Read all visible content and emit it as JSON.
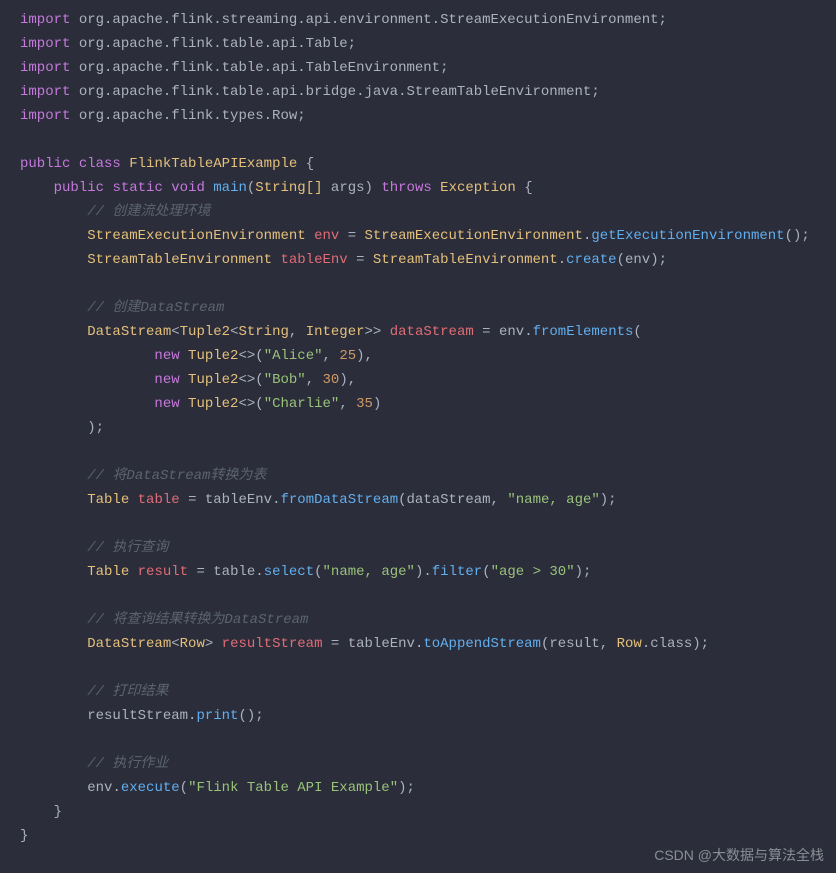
{
  "imports": [
    "org.apache.flink.streaming.api.environment.StreamExecutionEnvironment",
    "org.apache.flink.table.api.Table",
    "org.apache.flink.table.api.TableEnvironment",
    "org.apache.flink.table.api.bridge.java.StreamTableEnvironment",
    "org.apache.flink.types.Row"
  ],
  "kw": {
    "import": "import",
    "public": "public",
    "class": "class",
    "static": "static",
    "void": "void",
    "throws": "throws",
    "new": "new"
  },
  "className": "FlinkTableAPIExample",
  "mainMethod": "main",
  "mainArgsType": "String[]",
  "mainArgsName": "args",
  "throwsType": "Exception",
  "comments": {
    "createEnv": "// 创建流处理环境",
    "createDS": "// 创建DataStream",
    "toTable": "// 将DataStream转换为表",
    "query": "// 执行查询",
    "back": "// 将查询结果转换为DataStream",
    "print": "// 打印结果",
    "execute": "// 执行作业"
  },
  "types": {
    "StreamExecutionEnvironment": "StreamExecutionEnvironment",
    "StreamTableEnvironment": "StreamTableEnvironment",
    "DataStream": "DataStream",
    "Tuple2": "Tuple2",
    "String": "String",
    "Integer": "Integer",
    "Table": "Table",
    "Row": "Row"
  },
  "vars": {
    "env": "env",
    "tableEnv": "tableEnv",
    "dataStream": "dataStream",
    "table": "table",
    "result": "result",
    "resultStream": "resultStream"
  },
  "methods": {
    "getExecutionEnvironment": "getExecutionEnvironment",
    "create": "create",
    "fromElements": "fromElements",
    "fromDataStream": "fromDataStream",
    "select": "select",
    "filter": "filter",
    "toAppendStream": "toAppendStream",
    "print": "print",
    "execute": "execute",
    "classRef": "class"
  },
  "tuples": [
    {
      "name": "\"Alice\"",
      "age": "25"
    },
    {
      "name": "\"Bob\"",
      "age": "30"
    },
    {
      "name": "\"Charlie\"",
      "age": "35"
    }
  ],
  "strings": {
    "nameAge": "\"name, age\"",
    "select": "\"name, age\"",
    "filter": "\"age > 30\"",
    "exec": "\"Flink Table API Example\""
  },
  "chart_data": {
    "type": "table",
    "title": "Tuple2 dataset",
    "columns": [
      "name",
      "age"
    ],
    "rows": [
      [
        "Alice",
        25
      ],
      [
        "Bob",
        30
      ],
      [
        "Charlie",
        35
      ]
    ]
  },
  "watermark": "CSDN @大数据与算法全栈"
}
